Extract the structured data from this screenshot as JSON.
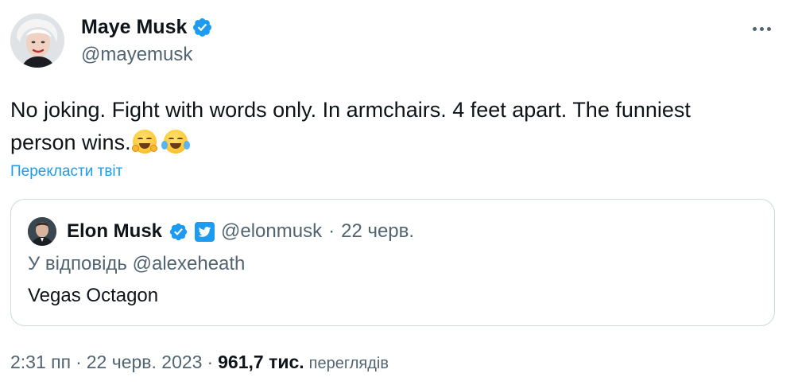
{
  "author": {
    "display_name": "Maye Musk",
    "handle": "@mayemusk"
  },
  "tweet": {
    "text_line1": "No joking. Fight with words only. In armchairs. 4 feet apart.  The funniest",
    "text_line2": "person wins.",
    "emojis": [
      "hugging-face-emoji",
      "tears-of-joy-emoji"
    ],
    "translate_label": "Перекласти твіт"
  },
  "quote": {
    "display_name": "Elon Musk",
    "handle": "@elonmusk",
    "separator": "·",
    "date": "22 черв.",
    "reply_prefix": "У відповідь",
    "reply_mention": "@alexeheath",
    "text": "Vegas Octagon"
  },
  "meta": {
    "time": "2:31 пп",
    "separator": "·",
    "date": "22 черв. 2023",
    "views_count": "961,7 тис.",
    "views_label": "переглядів"
  },
  "colors": {
    "accent": "#1d9bf0",
    "secondary_text": "#536471",
    "primary_text": "#0f1419",
    "border": "#cfd9de"
  },
  "icons": {
    "verified": "verified-badge-icon",
    "affiliate": "twitter-bird-affiliate-icon",
    "more": "more-horizontal-icon"
  }
}
